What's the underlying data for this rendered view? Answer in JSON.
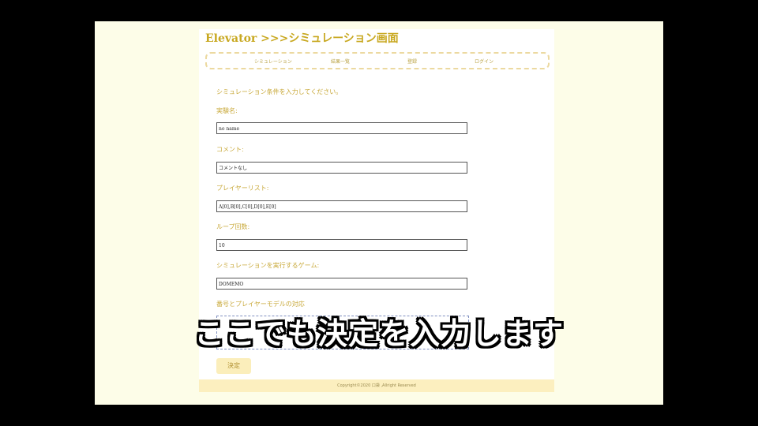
{
  "header": {
    "title": "Elevator >>>シミュレーション画面"
  },
  "nav": {
    "items": [
      "シミュレーション",
      "結果一覧",
      "登録",
      "ログイン"
    ]
  },
  "form": {
    "intro": "シミュレーション条件を入力してください。",
    "fields": [
      {
        "label": "実験名:",
        "value": "no name"
      },
      {
        "label": "コメント:",
        "value": "コメントなし"
      },
      {
        "label": "プレイヤーリスト:",
        "value": "A[0],B[0],C[0],D[0],E[0]"
      },
      {
        "label": "ループ回数:",
        "value": "10"
      },
      {
        "label": "シミュレーションを実行するゲーム:",
        "value": "DOMEMO"
      }
    ],
    "mapping_label": "番号とプレイヤーモデルの対応",
    "submit_label": "決定"
  },
  "footer": {
    "copyright": "Copyright©2020 口袋 ,Allright Reserved"
  },
  "caption": "ここでも決定を入力します",
  "colors": {
    "accent": "#c8a820",
    "background": "#fdfde8",
    "footer": "#fcefbf",
    "button": "#fbeebb"
  }
}
